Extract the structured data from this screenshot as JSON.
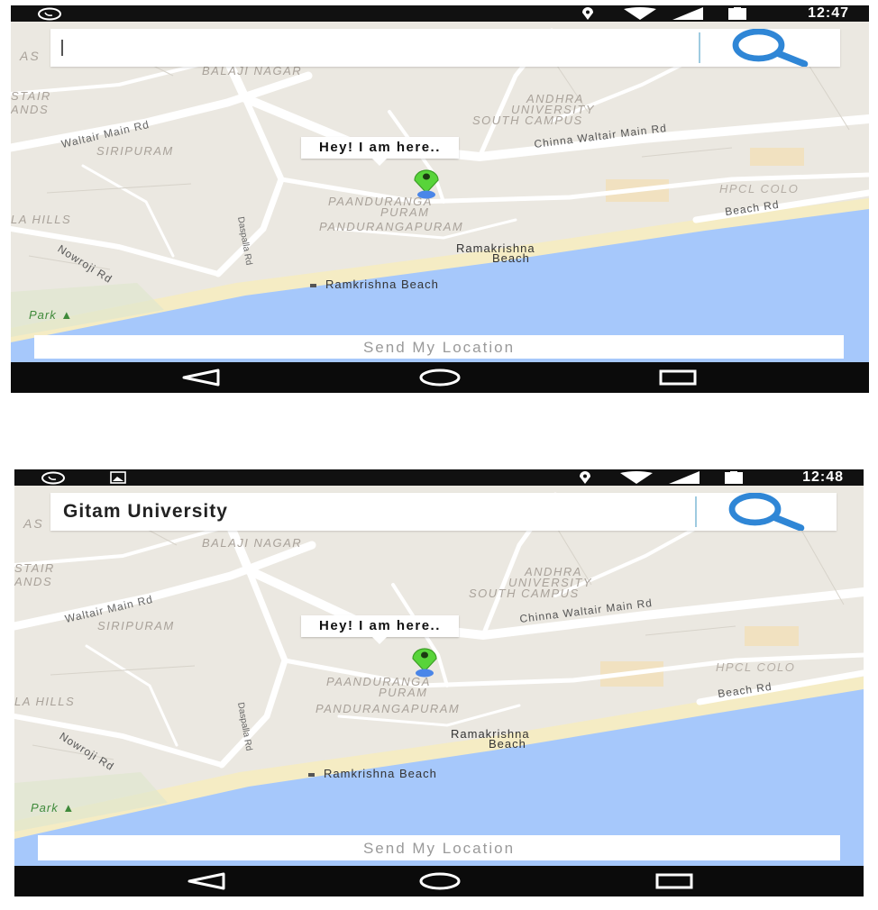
{
  "screens": [
    {
      "status": {
        "time": "12:47"
      },
      "search": {
        "value": "",
        "placeholder": ""
      },
      "marker": {
        "info": "Hey! I am here.."
      },
      "send_button": "Send My Location"
    },
    {
      "status": {
        "time": "12:48"
      },
      "search": {
        "value": "Gitam University",
        "placeholder": ""
      },
      "marker": {
        "info": "Hey! I am here.."
      },
      "send_button": "Send My Location"
    }
  ],
  "map_labels": {
    "balaji_nagar": "BALAJI NAGAR",
    "as": "AS",
    "stair": "STAIR",
    "ands": "ANDS",
    "andhra": "ANDHRA",
    "university": "UNIVERSITY",
    "south_campus": "SOUTH CAMPUS",
    "waltair_main_rd": "Waltair Main Rd",
    "siripuram": "SIRIPURAM",
    "chinna_waltair": "Chinna Waltair Main Rd",
    "hpcl": "HPCL COLO",
    "beach_rd": "Beach Rd",
    "paanduranga": "PAANDURANGA",
    "puram": "PURAM",
    "pandurangapuram": "PANDURANGAPURAM",
    "la_hills": "LA HILLS",
    "ramakrishna": "Ramakrishna",
    "beach": "Beach",
    "ramkrishna_beach": "Ramkrishna Beach",
    "nowroji_rd": "Nowroji Rd",
    "park": "Park",
    "dr_road": "Daspalla Rd"
  },
  "icons": {
    "status_left": [
      "whatsapp-icon",
      "image-icon"
    ],
    "status_right": [
      "location-icon",
      "wifi-icon",
      "signal-icon",
      "battery-icon"
    ],
    "nav": [
      "back-icon",
      "home-icon",
      "recents-icon"
    ],
    "search": "search-icon"
  },
  "colors": {
    "land": "#ebe8e1",
    "water": "#a6c8fb",
    "sand": "#f5ecc4",
    "road": "#ffffff",
    "marker_green": "#58d43a",
    "marker_dot": "#4a86e8",
    "search_blue": "#2f86d6",
    "bars": "#111111"
  }
}
